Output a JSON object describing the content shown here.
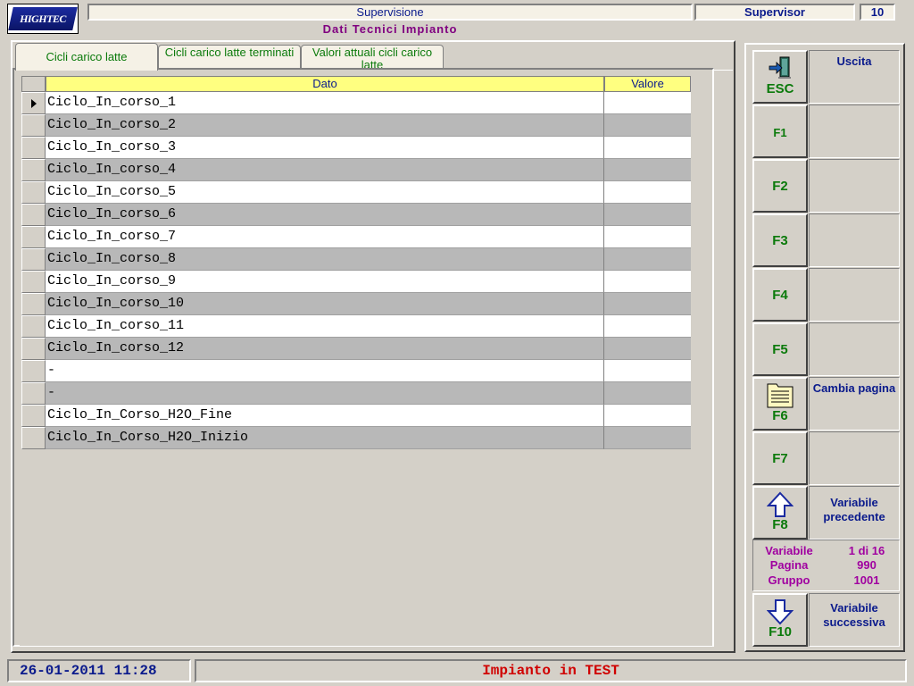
{
  "header": {
    "logo_text": "HIGHTEC",
    "title": "Supervisione",
    "subtitle": "Dati Tecnici Impianto",
    "user": "Supervisor",
    "level": "10"
  },
  "tabs": [
    {
      "label": "Cicli carico latte",
      "active": true
    },
    {
      "label": "Cicli carico latte terminati",
      "active": false
    },
    {
      "label": "Valori attuali cicli carico latte",
      "active": false
    }
  ],
  "grid": {
    "columns": [
      "Dato",
      "Valore"
    ],
    "rows": [
      {
        "name": "Ciclo_In_corso_1",
        "value": "",
        "selected": true
      },
      {
        "name": "Ciclo_In_corso_2",
        "value": ""
      },
      {
        "name": "Ciclo_In_corso_3",
        "value": ""
      },
      {
        "name": "Ciclo_In_corso_4",
        "value": ""
      },
      {
        "name": "Ciclo_In_corso_5",
        "value": ""
      },
      {
        "name": "Ciclo_In_corso_6",
        "value": ""
      },
      {
        "name": "Ciclo_In_corso_7",
        "value": ""
      },
      {
        "name": "Ciclo_In_corso_8",
        "value": ""
      },
      {
        "name": "Ciclo_In_corso_9",
        "value": ""
      },
      {
        "name": "Ciclo_In_corso_10",
        "value": ""
      },
      {
        "name": "Ciclo_In_corso_11",
        "value": ""
      },
      {
        "name": "Ciclo_In_corso_12",
        "value": ""
      },
      {
        "name": "-",
        "value": ""
      },
      {
        "name": "-",
        "value": ""
      },
      {
        "name": "Ciclo_In_Corso_H2O_Fine",
        "value": ""
      },
      {
        "name": "Ciclo_In_Corso_H2O_Inizio",
        "value": ""
      }
    ]
  },
  "function_keys": [
    {
      "key": "ESC",
      "description": "Uscita",
      "icon": "exit-door-icon"
    },
    {
      "key": "F1",
      "description": ""
    },
    {
      "key": "F2",
      "description": ""
    },
    {
      "key": "F3",
      "description": ""
    },
    {
      "key": "F4",
      "description": ""
    },
    {
      "key": "F5",
      "description": ""
    },
    {
      "key": "F6",
      "description": "Cambia pagina",
      "icon": "page-folder-icon"
    },
    {
      "key": "F7",
      "description": ""
    },
    {
      "key": "F8",
      "description": "Variabile precedente",
      "icon": "arrow-up-icon"
    },
    {
      "key": "F10",
      "description": "Variabile successiva",
      "icon": "arrow-down-icon"
    }
  ],
  "info": {
    "variabile_label": "Variabile",
    "variabile_value": "1 di 16",
    "pagina_label": "Pagina",
    "pagina_value": "990",
    "gruppo_label": "Gruppo",
    "gruppo_value": "1001"
  },
  "footer": {
    "datetime": "26-01-2011 11:28",
    "status": "Impianto in TEST"
  },
  "colors": {
    "accent_blue": "#0a1a8c",
    "key_green": "#0b7a0b",
    "status_red": "#d00000",
    "info_purple": "#a000a0",
    "header_yellow": "#ffff80"
  }
}
